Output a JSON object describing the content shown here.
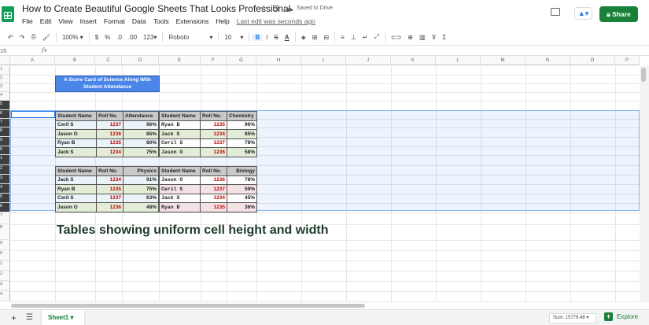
{
  "doc": {
    "title": "How to Create Beautiful Google Sheets That Looks Professional",
    "saved_status": "Saved to Drive",
    "last_edit": "Last edit was seconds ago",
    "share_label": "Share",
    "present_glyph": "▲▾",
    "icons": [
      "sheets-logo-icon",
      "star-icon",
      "move-folder-icon",
      "cloud-saved-icon",
      "comment-icon",
      "present-icon",
      "lock-icon"
    ]
  },
  "menu": [
    "File",
    "Edit",
    "View",
    "Insert",
    "Format",
    "Data",
    "Tools",
    "Extensions",
    "Help"
  ],
  "toolbar": {
    "undo": "↶",
    "redo": "↷",
    "print": "⎙",
    "paint": "🖌",
    "zoom": "100%",
    "currency": "$",
    "percent": "%",
    "dec_less": ".0",
    "dec_more": ".00",
    "more_formats": "123",
    "font": "Roboto",
    "font_size": "10",
    "bold": "B",
    "italic": "I",
    "strike": "S",
    "text_color": "A",
    "fill": "◈",
    "borders": "⊞",
    "merge": "⊟",
    "halign": "≡",
    "valign": "⊥",
    "wrap": "↵",
    "rotate": "⤢",
    "link": "⊂⊃",
    "comment": "⊕",
    "chart": "▥",
    "filter": "⊽",
    "functions": "Σ"
  },
  "formula_bar": {
    "name_box": "15",
    "fx": "fx"
  },
  "columns": [
    "A",
    "B",
    "C",
    "D",
    "E",
    "F",
    "G",
    "H",
    "I",
    "J",
    "K",
    "L",
    "M",
    "N",
    "O",
    "P"
  ],
  "rows": [
    "1",
    "2",
    "3",
    "4",
    "5",
    "6",
    "7",
    "8",
    "9",
    "0",
    "1",
    "2",
    "3",
    "4",
    "5",
    "6",
    "7",
    "8",
    "9",
    "0",
    "1",
    "2",
    "3",
    "4"
  ],
  "sheet_title": "A Score Card of Science Along With Student Attendance",
  "tables": {
    "attendance": {
      "headers": [
        "Student Name",
        "Roll No.",
        "Attendance"
      ],
      "rows": [
        [
          "Ceril S",
          "1237",
          "96%"
        ],
        [
          "Jason O",
          "1236",
          "85%"
        ],
        [
          "Ryan B",
          "1235",
          "80%"
        ],
        [
          "Jack S",
          "1234",
          "75%"
        ]
      ]
    },
    "chemistry": {
      "headers": [
        "Student Name",
        "Roll No.",
        "Chemistry"
      ],
      "rows": [
        [
          "Ryan B",
          "1235",
          "96%"
        ],
        [
          "Jack S",
          "1234",
          "85%"
        ],
        [
          "Ceril S",
          "1237",
          "78%"
        ],
        [
          "Jason O",
          "1236",
          "58%"
        ]
      ]
    },
    "physics": {
      "headers": [
        "Student Name",
        "Roll No.",
        "Physics"
      ],
      "rows": [
        [
          "Jack S",
          "1234",
          "91%"
        ],
        [
          "Ryan B",
          "1235",
          "75%"
        ],
        [
          "Ceril S",
          "1237",
          "63%"
        ],
        [
          "Jason O",
          "1236",
          "48%"
        ]
      ]
    },
    "biology": {
      "headers": [
        "Student Name",
        "Roll No.",
        "Biology"
      ],
      "rows": [
        [
          "Jason O",
          "1236",
          "78%"
        ],
        [
          "Ceril S",
          "1237",
          "59%"
        ],
        [
          "Jack S",
          "1234",
          "45%"
        ],
        [
          "Ryan B",
          "1235",
          "36%"
        ]
      ]
    }
  },
  "caption": "Tables showing uniform cell height and width",
  "bottom": {
    "sheet_tab": "Sheet1",
    "sum": "Sum: 15779.48",
    "explore": "Explore"
  }
}
